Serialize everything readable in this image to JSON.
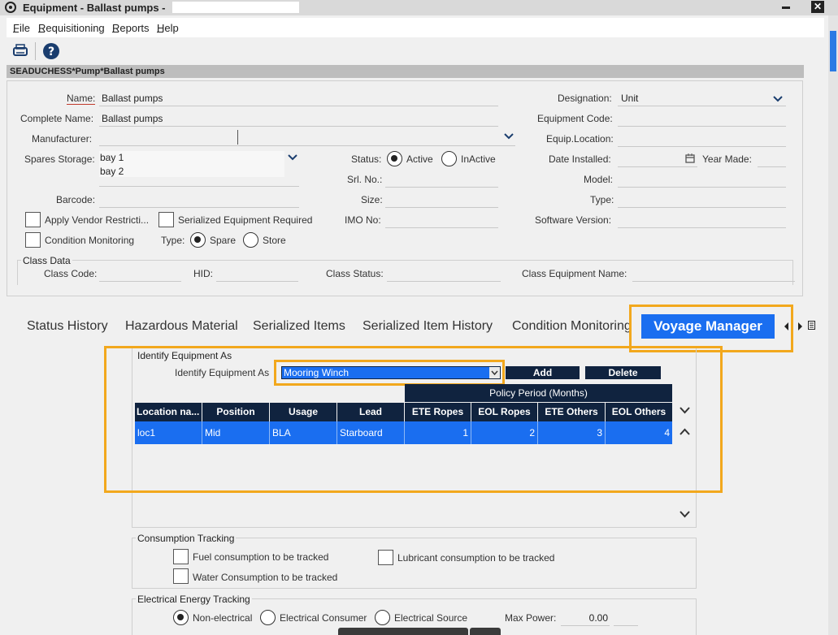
{
  "window": {
    "title": "Equipment - Ballast pumps -",
    "minimize": "▬",
    "close": "✕"
  },
  "menu": {
    "file": "File",
    "requisitioning": "Requisitioning",
    "reports": "Reports",
    "help": "Help"
  },
  "breadcrumb": "SEADUCHESS*Pump*Ballast pumps",
  "form": {
    "name_label": "Name:",
    "name_value": "Ballast pumps",
    "complete_name_label": "Complete Name:",
    "complete_name_value": "Ballast pumps",
    "manufacturer_label": "Manufacturer:",
    "spares_storage_label": "Spares Storage:",
    "spares_storage_values": [
      "bay 1",
      "bay 2"
    ],
    "barcode_label": "Barcode:",
    "apply_vendor_label": "Apply Vendor Restricti...",
    "serialized_required_label": "Serialized Equipment Required",
    "condition_monitoring_label": "Condition Monitoring",
    "type_label": "Type:",
    "type_options": [
      "Spare",
      "Store"
    ],
    "type_selected": "Spare",
    "status_label": "Status:",
    "status_options": [
      "Active",
      "InActive"
    ],
    "status_selected": "Active",
    "srl_no_label": "Srl. No.:",
    "size_label": "Size:",
    "imo_no_label": "IMO No:",
    "designation_label": "Designation:",
    "designation_value": "Unit",
    "equipment_code_label": "Equipment Code:",
    "equip_location_label": "Equip.Location:",
    "date_installed_label": "Date Installed:",
    "year_made_label": "Year Made:",
    "model_label": "Model:",
    "type2_label": "Type:",
    "software_version_label": "Software Version:"
  },
  "class_data": {
    "legend": "Class Data",
    "class_code_label": "Class Code:",
    "hid_label": "HID:",
    "class_status_label": "Class Status:",
    "class_equipment_name_label": "Class Equipment Name:"
  },
  "tabs": [
    {
      "label": "Status History"
    },
    {
      "label": "Hazardous Material"
    },
    {
      "label": "Serialized Items"
    },
    {
      "label": "Serialized Item History"
    },
    {
      "label": "Condition Monitoring"
    },
    {
      "label": "Voyage Manager"
    }
  ],
  "voyage": {
    "legend": "Identify Equipment As",
    "identify_label": "Identify Equipment As",
    "identify_value": "Mooring Winch",
    "add_button": "Add",
    "delete_button": "Delete",
    "policy_header": "Policy Period (Months)",
    "columns": [
      "Location na...",
      "Position",
      "Usage",
      "Lead",
      "ETE Ropes",
      "EOL Ropes",
      "ETE Others",
      "EOL Others"
    ],
    "rows": [
      {
        "location": "loc1",
        "position": "Mid",
        "usage": "BLA",
        "lead": "Starboard",
        "ete_ropes": "1",
        "eol_ropes": "2",
        "ete_others": "3",
        "eol_others": "4"
      }
    ]
  },
  "consumption": {
    "legend": "Consumption Tracking",
    "fuel": "Fuel consumption to be tracked",
    "lubricant": "Lubricant consumption to be tracked",
    "water": "Water Consumption to be tracked"
  },
  "electrical": {
    "legend": "Electrical Energy Tracking",
    "options": [
      "Non-electrical",
      "Electrical Consumer",
      "Electrical Source"
    ],
    "selected": "Non-electrical",
    "max_power_label": "Max Power:",
    "max_power_value": "0.00"
  },
  "colors": {
    "accent_orange": "#f2a81d",
    "selected_blue": "#1a6ef0",
    "header_navy": "#10233f"
  }
}
